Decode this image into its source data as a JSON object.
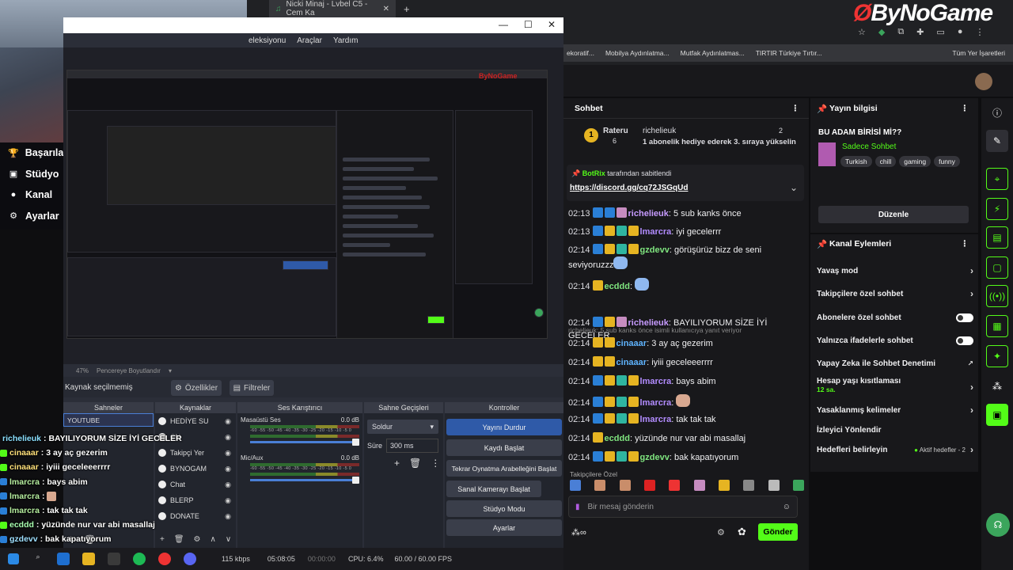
{
  "browser_tabs": [
    "Nicki Minaj - Lvbel C5 - Cem Ka"
  ],
  "obs": {
    "menu": [
      "eleksiyonu",
      "Araçlar",
      "Yardım"
    ],
    "zoom": "47%",
    "fit_label": "Pencereye Boyutlandır",
    "no_source": "Kaynak seçilmemiş",
    "properties": "Özellikler",
    "filters": "Filtreler",
    "docks": {
      "scenes": "Sahneler",
      "sources": "Kaynaklar",
      "mixer": "Ses Karıştırıcı",
      "transitions": "Sahne Geçişleri",
      "controls": "Kontroller"
    },
    "scenes": [
      "YOUTUBE"
    ],
    "sources": [
      "HEDİYE SU",
      "ÇN",
      "Takipçi Yer",
      "BYNOGAM",
      "Chat",
      "BLERP",
      "DONATE"
    ],
    "mixer": [
      {
        "name": "Masaüstü Ses",
        "db": "0.0 dB"
      },
      {
        "name": "Mic/Aux",
        "db": "0.0 dB"
      }
    ],
    "meter_ticks": "-60 -55 -50 -45 -40 -35 -30 -25 -20 -15 -10 -5 0",
    "transition": "Soldur",
    "duration_label": "Süre",
    "duration": "300 ms",
    "controls": [
      "Yayını Durdur",
      "Kaydı Başlat",
      "Tekrar Oynatma Arabelleğini Başlat",
      "Sanal Kamerayı Başlat",
      "Stüdyo Modu",
      "Ayarlar"
    ],
    "status": {
      "kbps": "115 kbps",
      "time1": "05:08:05",
      "time2": "00:00:00",
      "cpu": "CPU: 6.4%",
      "fps": "60.00 / 60.00 FPS"
    }
  },
  "left_nav": [
    "Başarılar",
    "Stüdyo",
    "Kanal",
    "Ayarlar"
  ],
  "overlay_chat": [
    {
      "user": "richelieuk",
      "text": ": BAYILIYORUM SİZE İYİ GECELER",
      "color": "#8be0ff"
    },
    {
      "user": "cinaaar",
      "text": ": 3 ay aç gezerim",
      "color": "#ffe07a"
    },
    {
      "user": "cinaaar",
      "text": ": iyiii geceleeerrrr",
      "color": "#ffe07a"
    },
    {
      "user": "lmarcra",
      "text": ": bays abim",
      "color": "#b7f0a0"
    },
    {
      "user": "lmarcra",
      "text": ":",
      "color": "#b7f0a0"
    },
    {
      "user": "lmarcra",
      "text": ": tak tak tak",
      "color": "#b7f0a0"
    },
    {
      "user": "ecddd",
      "text": ": yüzünde nur var abi masallaj",
      "color": "#a8ffb0"
    },
    {
      "user": "gzdevv",
      "text": ": bak kapatıyorum",
      "color": "#9fe0ff"
    }
  ],
  "bookmarks": [
    "ekoratif...",
    "Mobilya Aydınlatma...",
    "Mutfak Aydınlatmas...",
    "TIRTIR Türkiye Tırtır...",
    "Tüm Yer İşaretleri"
  ],
  "logo": "ByNoGame",
  "chat": {
    "title": "Sohbet",
    "gift": {
      "user": "Rateru",
      "count": "6",
      "gifter": "richelieuk",
      "subs": "2",
      "text": "1 abonelik hediye ederek 3. sıraya yükselin"
    },
    "pinned": {
      "by": "BotRix",
      "suffix": "tarafından sabitlendi",
      "link": "https://discord.gg/cq72JSGqUd"
    },
    "messages": [
      {
        "time": "02:13",
        "user": "richelieuk",
        "text": "5 sub kanks önce",
        "color": "#c79bff"
      },
      {
        "time": "02:13",
        "user": "lmarcra",
        "text": "iyi gecelerrr",
        "color": "#b28cff"
      },
      {
        "time": "02:14",
        "user": "gzdevv",
        "text": "görüşürüz bizz de seni seviyoruzzz",
        "color": "#7fe57f"
      },
      {
        "time": "02:14",
        "user": "ecddd",
        "text": "",
        "color": "#7fe57f"
      },
      {
        "time": "02:14",
        "user": "richelieuk",
        "text": "BAYILIYORUM SİZE İYİ GECELER",
        "color": "#c79bff"
      },
      {
        "time": "02:14",
        "user": "cinaaar",
        "text": "3 ay aç gezerim",
        "color": "#5fb4ff"
      },
      {
        "time": "02:14",
        "user": "cinaaar",
        "text": "iyiii geceleeerrrr",
        "color": "#5fb4ff"
      },
      {
        "time": "02:14",
        "user": "lmarcra",
        "text": "bays abim",
        "color": "#b28cff"
      },
      {
        "time": "02:14",
        "user": "lmarcra",
        "text": "",
        "color": "#b28cff"
      },
      {
        "time": "02:14",
        "user": "lmarcra",
        "text": "tak tak tak",
        "color": "#b28cff"
      },
      {
        "time": "02:14",
        "user": "ecddd",
        "text": "yüzünde nur var abi masallaj",
        "color": "#7fe57f"
      },
      {
        "time": "02:14",
        "user": "gzdevv",
        "text": "bak kapatıyorum",
        "color": "#7fe57f"
      }
    ],
    "reply_note": "richelieuk: 5 sub kanks önce isimli kullanıcıya yanıt veriyor",
    "emotes_label": "Takipçilere Özel",
    "input_placeholder": "Bir mesaj gönderin",
    "send": "Gönder"
  },
  "stream_info": {
    "title": "Yayın bilgisi",
    "stream_title": "BU ADAM BİRİSİ Mİ??",
    "category": "Sadece Sohbet",
    "tags": [
      "Turkish",
      "chill",
      "gaming",
      "funny"
    ],
    "edit": "Düzenle"
  },
  "channel_actions": {
    "title": "Kanal Eylemleri",
    "items": [
      {
        "label": "Yavaş mod",
        "kind": "arrow"
      },
      {
        "label": "Takipçilere özel sohbet",
        "kind": "arrow"
      },
      {
        "label": "Abonelere özel sohbet",
        "kind": "toggle"
      },
      {
        "label": "Yalnızca ifadelerle sohbet",
        "kind": "toggle"
      },
      {
        "label": "Yapay Zeka ile Sohbet Denetimi",
        "kind": "ext"
      },
      {
        "label": "Hesap yaşı kısıtlaması",
        "sub": "12 sa.",
        "kind": "arrow"
      },
      {
        "label": "Yasaklanmış kelimeler",
        "kind": "arrow"
      },
      {
        "label": "İzleyici Yönlendir",
        "kind": "none"
      },
      {
        "label": "Hedefleri belirleyin",
        "sub": "Aktif hedefler - 2",
        "kind": "arrow"
      }
    ]
  }
}
